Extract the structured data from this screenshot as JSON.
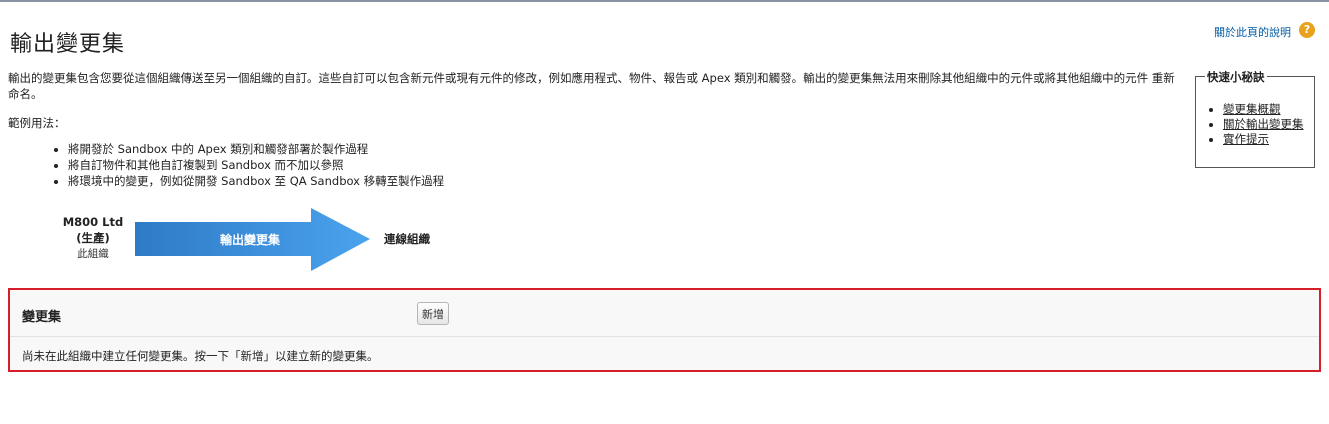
{
  "page": {
    "title": "輸出變更集",
    "help_link": "關於此頁的說明",
    "help_icon": "question-circle-icon"
  },
  "intro": "輸出的變更集包含您要從這個組織傳送至另一個組織的自訂。這些自訂可以包含新元件或現有元件的修改，例如應用程式、物件、報告或 Apex 類別和觸發。輸出的變更集無法用來刪除其他組織中的元件或將其他組織中的元件 重新命名。",
  "usage": {
    "title": "範例用法：",
    "items": [
      "將開發於 Sandbox 中的 Apex 類別和觸發部署於製作過程",
      "將自訂物件和其他自訂複製到 Sandbox 而不加以參照",
      "將環境中的變更，例如從開發 Sandbox 至 QA Sandbox 移轉至製作過程"
    ]
  },
  "tips": {
    "title": "快速小秘訣",
    "links": [
      "變更集概觀",
      "關於輸出變更集",
      "實作提示"
    ]
  },
  "diagram": {
    "org_name": "M800 Ltd",
    "org_env": "(生產)",
    "org_here": "此組織",
    "arrow_label": "輸出變更集",
    "target": "連線組織",
    "arrow_color": "#3d8fdc"
  },
  "changesets": {
    "title": "變更集",
    "new_button": "新增",
    "empty_message": "尚未在此組織中建立任何變更集。按一下「新增」以建立新的變更集。"
  }
}
